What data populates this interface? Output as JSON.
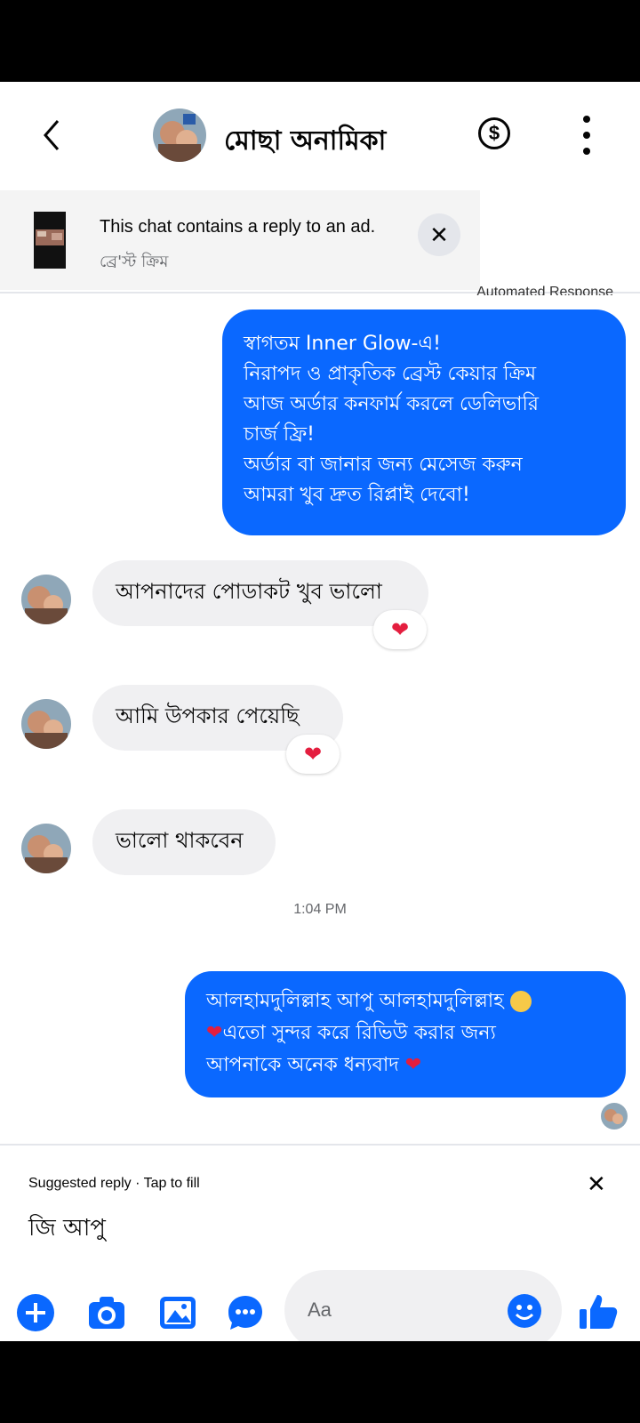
{
  "header": {
    "contact_name": "মোছা অনামিকা"
  },
  "ad_banner": {
    "title": "This chat contains a reply to an ad.",
    "subtitle": "ব্রে'স্ট ক্রিম"
  },
  "automated_label": "Automated Response",
  "messages": [
    {
      "direction": "out",
      "lines": [
        "স্বাগতম Inner Glow-এ!",
        "নিরাপদ ও প্রাকৃতিক ব্রেস্ট কেয়ার ক্রিম",
        "আজ অর্ডার কনফার্ম করলে ডেলিভারি",
        "চার্জ ফ্রি!",
        "অর্ডার বা জানার জন্য মেসেজ করুন",
        "আমরা খুব দ্রুত রিপ্লাই দেবো!"
      ]
    },
    {
      "direction": "in",
      "text": "আপনাদের পোডাকট খুব ভালো",
      "reaction": "heart"
    },
    {
      "direction": "in",
      "text": "আমি উপকার পেয়েছি",
      "reaction": "heart"
    },
    {
      "direction": "in",
      "text": "ভালো থাকবেন"
    },
    {
      "direction": "out",
      "lines": [
        "আলহামদুলিল্লাহ আপু আলহামদুলিল্লাহ",
        "এতো সুন্দর করে রিভিউ করার জন্য",
        "আপনাকে অনেক ধন্যবাদ"
      ]
    }
  ],
  "timestamp": "1:04 PM",
  "suggested_reply": {
    "label": "Suggested reply · Tap to fill",
    "text": "জি আপু"
  },
  "composer": {
    "placeholder": "Aa",
    "icons": [
      "plus-icon",
      "camera-icon",
      "gallery-icon",
      "chat-bubble-icon",
      "emoji-icon",
      "thumbs-up-icon"
    ]
  },
  "colors": {
    "accent": "#0a68ff",
    "bubble_in": "#f0f0f2",
    "heart": "#e41e3f"
  }
}
